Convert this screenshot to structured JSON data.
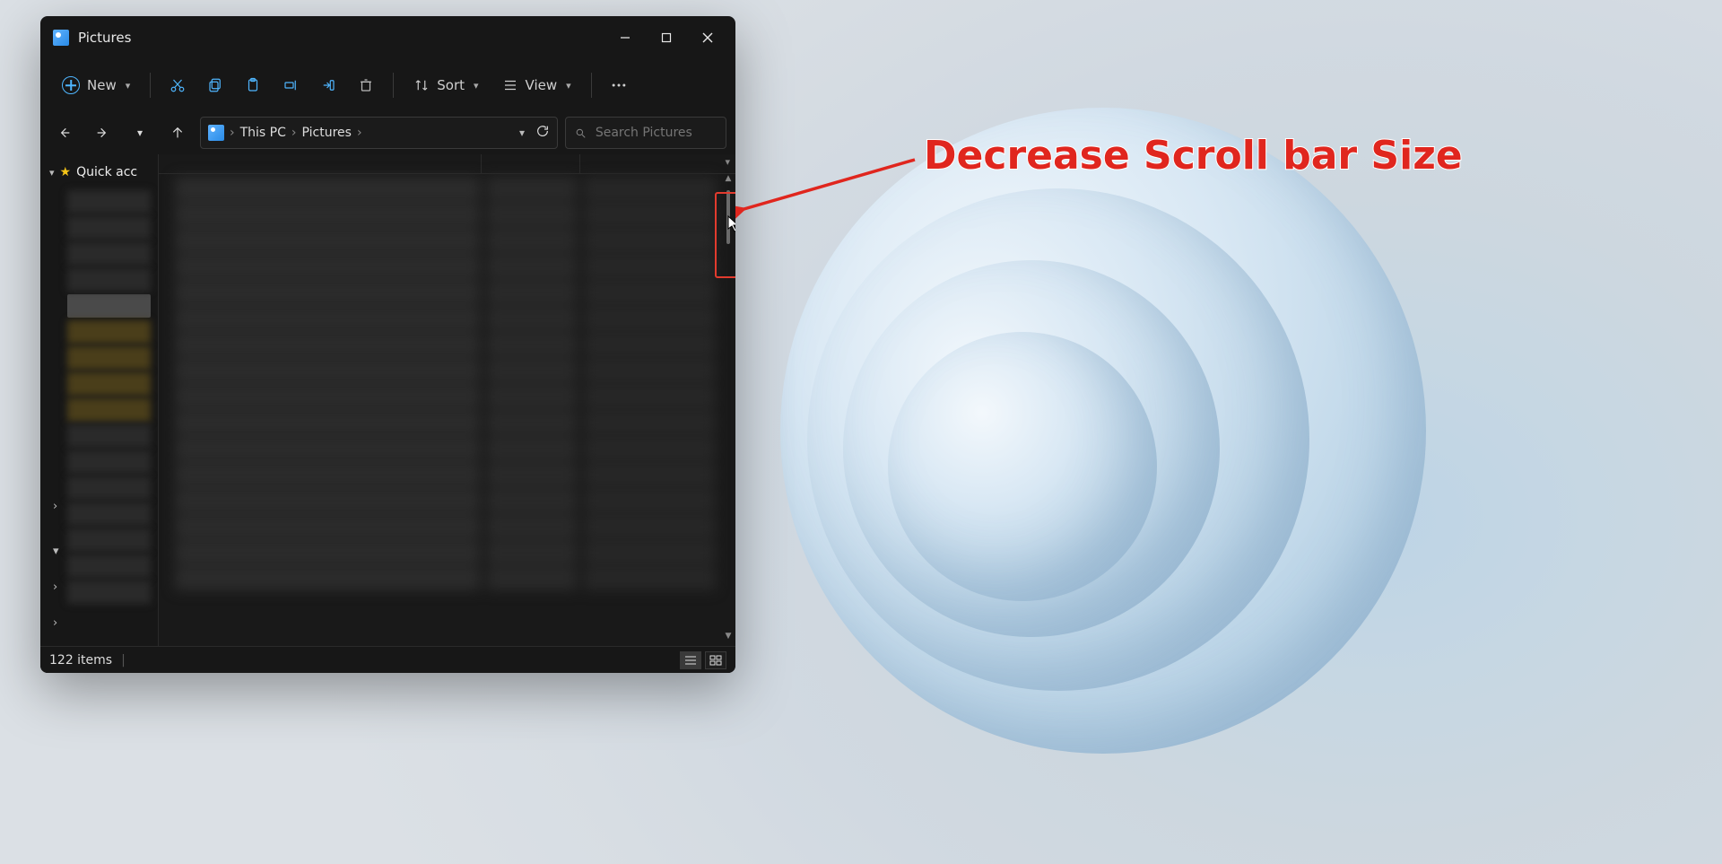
{
  "window": {
    "title": "Pictures"
  },
  "toolbar": {
    "new_label": "New",
    "sort_label": "Sort",
    "view_label": "View"
  },
  "breadcrumb": {
    "seg1": "This PC",
    "seg2": "Pictures"
  },
  "search": {
    "placeholder": "Search Pictures"
  },
  "navpane": {
    "quick_access_label": "Quick acc"
  },
  "status": {
    "count_text": "122 items"
  },
  "annotation": {
    "label": "Decrease Scroll bar Size",
    "color": "#e0261e"
  }
}
